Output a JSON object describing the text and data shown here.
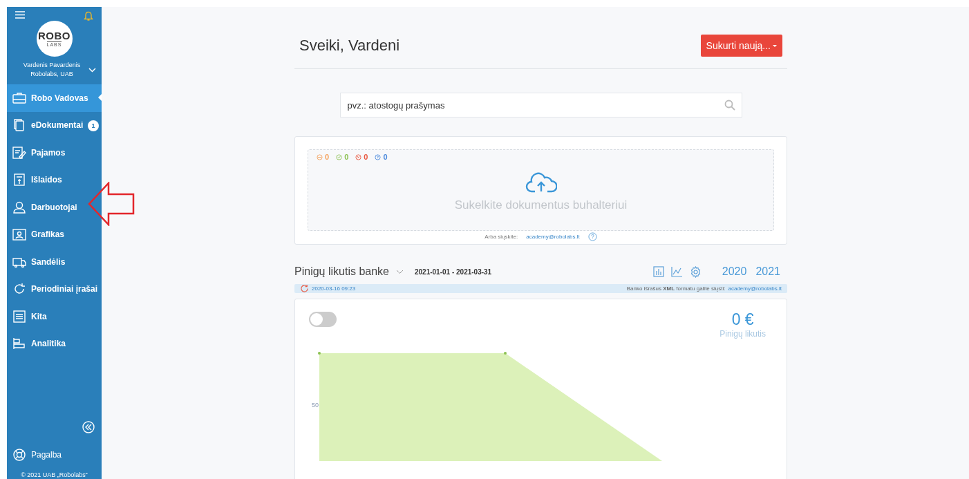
{
  "sidebar": {
    "logo_text": "ROBO",
    "logo_subtext": "LABS",
    "user_name": "Vardenis Pavardenis",
    "company": "Robolabs, UAB",
    "items": [
      {
        "label": "Robo Vadovas",
        "selected": true
      },
      {
        "label": "eDokumentai",
        "selected": false,
        "badge": "1"
      },
      {
        "label": "Pajamos",
        "selected": false
      },
      {
        "label": "Išlaidos",
        "selected": false
      },
      {
        "label": "Darbuotojai",
        "selected": false
      },
      {
        "label": "Grafikas",
        "selected": false
      },
      {
        "label": "Sandėlis",
        "selected": false
      },
      {
        "label": "Periodiniai įrašai",
        "selected": false
      },
      {
        "label": "Kita",
        "selected": false
      },
      {
        "label": "Analitika",
        "selected": false
      }
    ],
    "help": "Pagalba",
    "copyright": "© 2021 UAB „Robolabs“"
  },
  "header": {
    "greeting": "Sveiki, Vardeni",
    "create_button": "Sukurti naują..."
  },
  "search": {
    "placeholder": "pvz.: atostogų prašymas"
  },
  "upload": {
    "counters": [
      {
        "kind": "pending",
        "count": "0",
        "color": "#f5a25d"
      },
      {
        "kind": "done",
        "count": "0",
        "color": "#8cc152"
      },
      {
        "kind": "failed",
        "count": "0",
        "color": "#e9573f"
      },
      {
        "kind": "unknown",
        "count": "0",
        "color": "#4a89dc"
      }
    ],
    "prompt": "Sukelkite dokumentus buhalteriui",
    "email_label": "Arba siųskite:",
    "email": "academy@robolabs.lt"
  },
  "bank": {
    "title": "Pinigų likutis banke",
    "period": "2021-01-01 - 2021-03-31",
    "years": [
      "2020",
      "2021"
    ],
    "sync_time": "2020-03-16 09:23",
    "notice": "Banko išrašus **XML** formatu galite siųsti:",
    "notice_email": "academy@robolabs.lt",
    "toggle": {
      "on": false
    },
    "balance": "0 €",
    "balance_label": "Pinigų likutis",
    "y_tick": "50"
  }
}
